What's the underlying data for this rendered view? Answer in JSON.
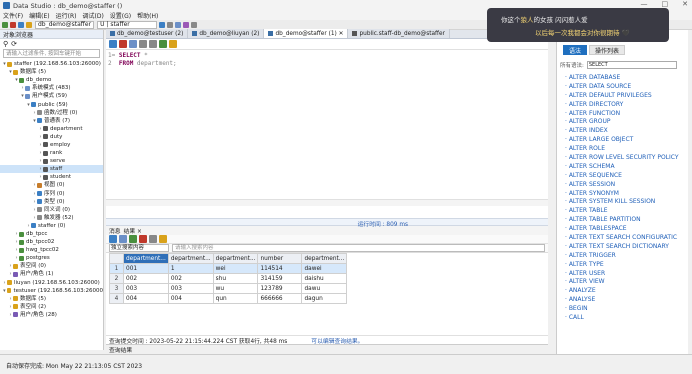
{
  "app": {
    "title": "Data Studio : db_demo@staffer ()",
    "window_controls": [
      "—",
      "□",
      "✕"
    ]
  },
  "menu": [
    "文件(F)",
    "编辑(E)",
    "运行(R)",
    "调试(D)",
    "设置(G)",
    "帮助(H)"
  ],
  "toolbar": {
    "connection": "db_demo@staffer",
    "user": "U | staffer"
  },
  "navigator": {
    "title": "对象浏览器",
    "filter_placeholder": "请输入过滤条件, 按回车键开始",
    "tree": [
      {
        "label": "staffer (192.168.56.103:26000)",
        "depth": 0,
        "arrow": "▾",
        "color": "#d9a21b"
      },
      {
        "label": "数据库 (5)",
        "depth": 1,
        "arrow": "▾",
        "color": "#d9a21b"
      },
      {
        "label": "db_demo",
        "depth": 2,
        "arrow": "▾",
        "color": "#4a8f3e"
      },
      {
        "label": "系统模式 (483)",
        "depth": 3,
        "arrow": "›",
        "color": "#6b8fc7"
      },
      {
        "label": "用户模式 (59)",
        "depth": 3,
        "arrow": "▾",
        "color": "#6b8fc7"
      },
      {
        "label": "public (59)",
        "depth": 4,
        "arrow": "▾",
        "color": "#3b7fc4"
      },
      {
        "label": "函数/过程 (0)",
        "depth": 5,
        "arrow": "›",
        "color": "#888"
      },
      {
        "label": "普通表 (7)",
        "depth": 5,
        "arrow": "▾",
        "color": "#3b7fc4"
      },
      {
        "label": "department",
        "depth": 6,
        "arrow": "›",
        "color": "#555"
      },
      {
        "label": "duty",
        "depth": 6,
        "arrow": "›",
        "color": "#555"
      },
      {
        "label": "employ",
        "depth": 6,
        "arrow": "›",
        "color": "#555"
      },
      {
        "label": "rank",
        "depth": 6,
        "arrow": "›",
        "color": "#555"
      },
      {
        "label": "serve",
        "depth": 6,
        "arrow": "›",
        "color": "#555"
      },
      {
        "label": "staff",
        "depth": 6,
        "arrow": "›",
        "color": "#555",
        "selected": true
      },
      {
        "label": "student",
        "depth": 6,
        "arrow": "›",
        "color": "#555"
      },
      {
        "label": "视图 (0)",
        "depth": 5,
        "arrow": "›",
        "color": "#c77d2b"
      },
      {
        "label": "序列 (0)",
        "depth": 5,
        "arrow": "›",
        "color": "#3b7fc4"
      },
      {
        "label": "类型 (0)",
        "depth": 5,
        "arrow": "›",
        "color": "#3b7fc4"
      },
      {
        "label": "同义词 (0)",
        "depth": 5,
        "arrow": "›",
        "color": "#888"
      },
      {
        "label": "触发器 (52)",
        "depth": 5,
        "arrow": "›",
        "color": "#888"
      },
      {
        "label": "staffer (0)",
        "depth": 4,
        "arrow": "›",
        "color": "#3b7fc4"
      },
      {
        "label": "db_tpcc",
        "depth": 2,
        "arrow": "›",
        "color": "#4a8f3e"
      },
      {
        "label": "db_tpcc02",
        "depth": 2,
        "arrow": "›",
        "color": "#4a8f3e"
      },
      {
        "label": "hwg_tpcc02",
        "depth": 2,
        "arrow": "›",
        "color": "#4a8f3e"
      },
      {
        "label": "postgres",
        "depth": 2,
        "arrow": "›",
        "color": "#4a8f3e"
      },
      {
        "label": "表空间 (0)",
        "depth": 1,
        "arrow": "›",
        "color": "#d9a21b"
      },
      {
        "label": "用户/角色 (1)",
        "depth": 1,
        "arrow": "›",
        "color": "#7a5bb5"
      },
      {
        "label": "liuyan (192.168.56.103:26000)",
        "depth": 0,
        "arrow": "›",
        "color": "#d9a21b"
      },
      {
        "label": "testuser (192.168.56.103:26000",
        "depth": 0,
        "arrow": "▾",
        "color": "#d9a21b"
      },
      {
        "label": "数据库 (5)",
        "depth": 1,
        "arrow": "›",
        "color": "#d9a21b"
      },
      {
        "label": "表空间 (2)",
        "depth": 1,
        "arrow": "›",
        "color": "#d9a21b"
      },
      {
        "label": "用户/角色 (28)",
        "depth": 1,
        "arrow": "›",
        "color": "#7a5bb5"
      }
    ]
  },
  "editor": {
    "tabs": [
      {
        "label": "db_demo@testuser (2)",
        "active": false
      },
      {
        "label": "db_demo@liuyan (2)",
        "active": false
      },
      {
        "label": "db_demo@staffer (1) ✕",
        "active": true
      },
      {
        "label": "public.staff-db_demo@staffer",
        "active": false
      }
    ],
    "lines": [
      {
        "num": "1",
        "kw": "SELECT",
        "rest": " *"
      },
      {
        "num": "2",
        "kw": "FROM",
        "rest": " department;"
      }
    ],
    "exec_time": "运行时间 : 809 ms"
  },
  "result": {
    "tabs": [
      "消息",
      "结果 ×"
    ],
    "search_scope": "独立搜索内容",
    "search_placeholder": "请输入搜索内容",
    "columns": [
      "",
      "department...",
      "department...",
      "department...",
      "number",
      "department..."
    ],
    "rows": [
      [
        "1",
        "001",
        "1",
        "wei",
        "114514",
        "dawei"
      ],
      [
        "2",
        "002",
        "002",
        "shu",
        "314159",
        "daishu"
      ],
      [
        "3",
        "003",
        "003",
        "wu",
        "123789",
        "dawu"
      ],
      [
        "4",
        "004",
        "004",
        "qun",
        "666666",
        "dagun"
      ]
    ],
    "footer": "查询提交时间 : 2023-05-22 21:15:44.224 CST   获取4行, 共48 ms",
    "footer_link": "可以编辑查询结果。",
    "bottom_tab": "查询结果"
  },
  "assist": {
    "tabs": [
      "语法",
      "操作列表"
    ],
    "syntax_label": "所有语法:",
    "syntax_value": "SELECT",
    "keywords": [
      "ALTER DATABASE",
      "ALTER DATA SOURCE",
      "ALTER DEFAULT PRIVILEGES",
      "ALTER DIRECTORY",
      "ALTER FUNCTION",
      "ALTER GROUP",
      "ALTER INDEX",
      "ALTER LARGE OBJECT",
      "ALTER ROLE",
      "ALTER ROW LEVEL SECURITY POLICY",
      "ALTER SCHEMA",
      "ALTER SEQUENCE",
      "ALTER SESSION",
      "ALTER SYNONYM",
      "ALTER SYSTEM KILL SESSION",
      "ALTER TABLE",
      "ALTER TABLE PARTITION",
      "ALTER TABLESPACE",
      "ALTER TEXT SEARCH CONFIGURATIC",
      "ALTER TEXT SEARCH DICTIONARY",
      "ALTER TRIGGER",
      "ALTER TYPE",
      "ALTER USER",
      "ALTER VIEW",
      "ANALYZE",
      "ANALYSE",
      "BEGIN",
      "CALL"
    ]
  },
  "overlay": {
    "line1a": "你这个",
    "line1b": "狼人",
    "line1c": "的女孩 闪闪惹人爱",
    "line2a": "以后每一次我都会对你很期待",
    "line2b": " 🖤"
  },
  "status": "自动保存完成: Mon May 22 21:13:05 CST 2023"
}
